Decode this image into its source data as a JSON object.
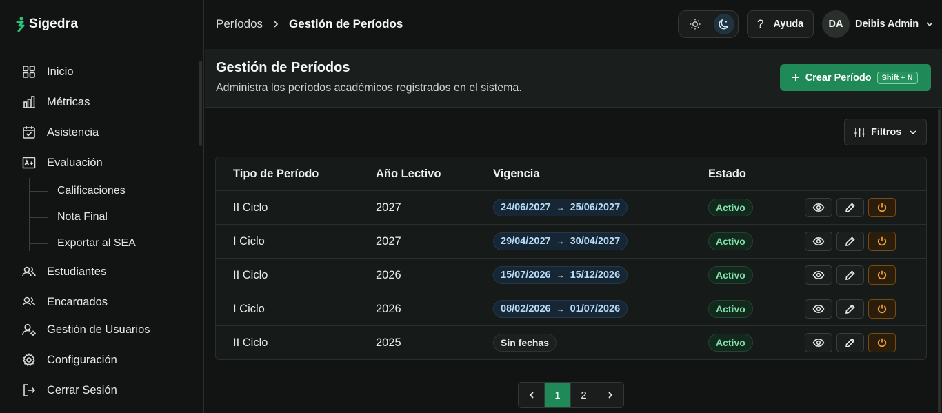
{
  "app": {
    "name": "Sigedra"
  },
  "sidebar": {
    "items": [
      {
        "label": "Inicio",
        "icon": "grid-icon"
      },
      {
        "label": "Métricas",
        "icon": "bar-chart-icon"
      },
      {
        "label": "Asistencia",
        "icon": "calendar-check-icon"
      },
      {
        "label": "Evaluación",
        "icon": "grade-icon"
      }
    ],
    "sub_items": [
      {
        "label": "Calificaciones"
      },
      {
        "label": "Nota Final"
      },
      {
        "label": "Exportar al SEA"
      }
    ],
    "after_items": [
      {
        "label": "Estudiantes",
        "icon": "users-icon"
      },
      {
        "label": "Encargados",
        "icon": "users-icon"
      }
    ],
    "bottom_items": [
      {
        "label": "Gestión de Usuarios",
        "icon": "user-gear-icon"
      },
      {
        "label": "Configuración",
        "icon": "gear-icon"
      },
      {
        "label": "Cerrar Sesión",
        "icon": "logout-icon"
      }
    ]
  },
  "topbar": {
    "breadcrumb": [
      "Períodos",
      "Gestión de Períodos"
    ],
    "help_label": "Ayuda",
    "theme": "dark",
    "user": {
      "initials": "DA",
      "name": "Deibis Admin"
    }
  },
  "page": {
    "title": "Gestión de Períodos",
    "subtitle": "Administra los períodos académicos registrados en el sistema.",
    "create_label": "Crear Período",
    "create_shortcut": "Shift + N",
    "filters_label": "Filtros"
  },
  "table": {
    "columns": [
      "Tipo de Período",
      "Año Lectivo",
      "Vigencia",
      "Estado"
    ],
    "rows": [
      {
        "tipo": "II Ciclo",
        "anio": "2027",
        "inicio": "24/06/2027",
        "fin": "25/06/2027",
        "estado": "Activo"
      },
      {
        "tipo": "I Ciclo",
        "anio": "2027",
        "inicio": "29/04/2027",
        "fin": "30/04/2027",
        "estado": "Activo"
      },
      {
        "tipo": "II Ciclo",
        "anio": "2026",
        "inicio": "15/07/2026",
        "fin": "15/12/2026",
        "estado": "Activo"
      },
      {
        "tipo": "I Ciclo",
        "anio": "2026",
        "inicio": "08/02/2026",
        "fin": "01/07/2026",
        "estado": "Activo"
      },
      {
        "tipo": "II Ciclo",
        "anio": "2025",
        "sin_fechas": "Sin fechas",
        "estado": "Activo"
      }
    ],
    "date_arrow": "→"
  },
  "pagination": {
    "pages": [
      "1",
      "2"
    ],
    "current": "1"
  },
  "colors": {
    "accent": "#1f8a57",
    "status": "#7fe0a8",
    "date": "#b7dcf7",
    "power": "#f2a23a"
  }
}
